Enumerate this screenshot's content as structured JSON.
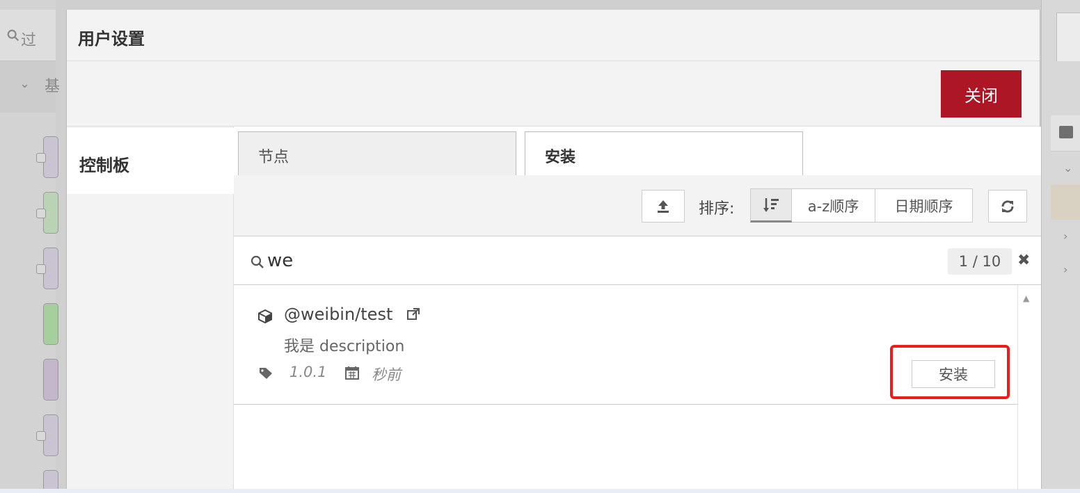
{
  "background": {
    "search_text": "过",
    "category_text": "基"
  },
  "dialog": {
    "title": "用户设置",
    "close_label": "关闭",
    "sidebar": {
      "active_item": "控制板"
    },
    "tabs": [
      {
        "label": "节点",
        "active": false
      },
      {
        "label": "安装",
        "active": true
      }
    ],
    "toolbar": {
      "sort_label": "排序:",
      "sort_options": [
        "a-z顺序",
        "日期顺序"
      ]
    },
    "search": {
      "value": "we",
      "count": "1 / 10"
    },
    "results": [
      {
        "name": "@weibin/test",
        "description": "我是 description",
        "version": "1.0.1",
        "updated": "秒前",
        "install_label": "安装"
      }
    ],
    "colors": {
      "close_button": "#ad1625",
      "highlight": "#ee1b1b"
    }
  }
}
